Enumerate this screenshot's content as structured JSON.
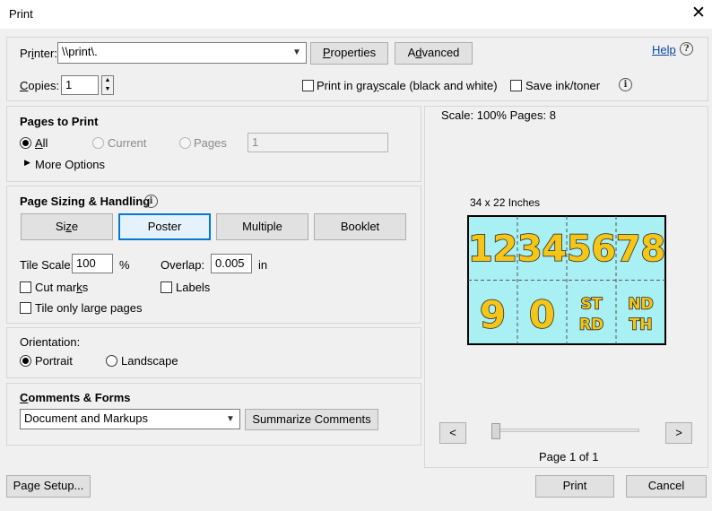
{
  "window": {
    "title": "Print"
  },
  "printer": {
    "label_pre": "Pr",
    "label_u": "i",
    "label_post": "nter:",
    "value": "\\\\print\\.",
    "properties_pre": "",
    "properties_u": "P",
    "properties_post": "roperties",
    "advanced_pre": "A",
    "advanced_u": "d",
    "advanced_post": "vanced",
    "help_label": "Help"
  },
  "copies": {
    "label_u": "C",
    "label_post": "opies:",
    "value": "1",
    "grayscale_pre": "Print in gra",
    "grayscale_u": "y",
    "grayscale_post": "scale (black and white)",
    "save_ink_label": "Save ink/toner"
  },
  "pages_to_print": {
    "title": "Pages to Print",
    "all_u": "A",
    "all_post": "ll",
    "current_label": "Current",
    "pages_label": "Pages",
    "pages_value": "1",
    "more_options_label": "More Options"
  },
  "sizing": {
    "title": "Page Sizing & Handling",
    "size_pre": "Si",
    "size_u": "z",
    "size_post": "e",
    "poster_label": "Poster",
    "multiple_label": "Multiple",
    "booklet_label": "Booklet",
    "tile_scale_label": "Tile Scale:",
    "tile_scale_value": "100",
    "tile_scale_unit": "%",
    "overlap_label": "Overlap:",
    "overlap_value": "0.005",
    "overlap_unit": "in",
    "cut_marks_label_pre": "Cut mar",
    "cut_marks_label_u": "k",
    "cut_marks_label_post": "s",
    "labels_label": "Labels",
    "tile_large_label": "Tile only large pages"
  },
  "orientation": {
    "title": "Orientation:",
    "portrait_label": "Portrait",
    "landscape_label": "Landscape"
  },
  "comments": {
    "title_u": "C",
    "title_post": "omments & Forms",
    "dropdown_value": "Document and Markups",
    "summarize_label": "Summarize Comments"
  },
  "preview": {
    "scale_text": "Scale: 100% Pages: 8",
    "dimensions": "34 x 22 Inches",
    "tiles_top": [
      "1",
      "2",
      "3",
      "4",
      "5",
      "6",
      "7",
      "8"
    ],
    "tiles_bottom": [
      "9",
      "0",
      "ST\nRD",
      "ND\nTH"
    ],
    "tile_bg": "#a8f0f4",
    "digit_color": "#f5c518",
    "prev_label": "<",
    "next_label": ">",
    "page_indicator": "Page 1 of 1"
  },
  "footer": {
    "page_setup_label": "Page Setup...",
    "print_label": "Print",
    "cancel_label": "Cancel"
  }
}
